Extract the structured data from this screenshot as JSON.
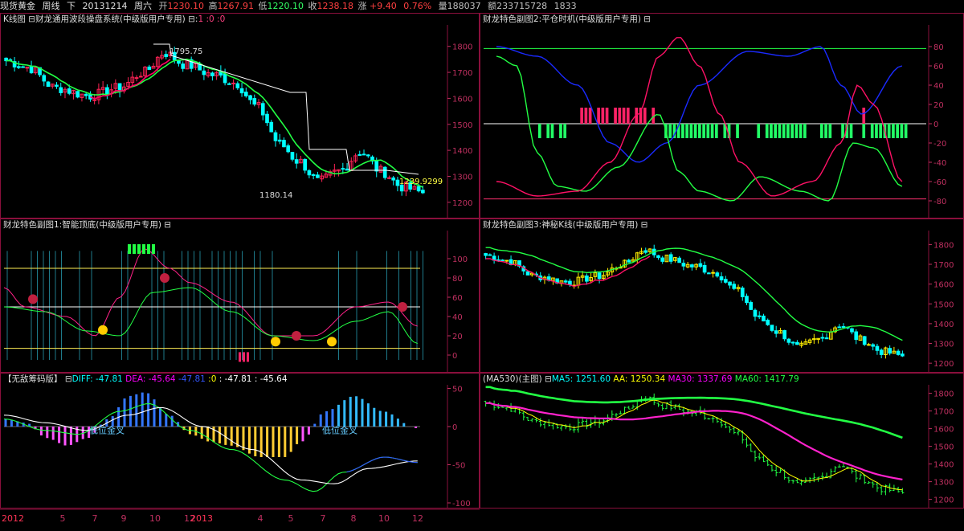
{
  "topbar": {
    "symbol": "现货黄金",
    "period": "周线",
    "dir": "下",
    "date": "20131214",
    "weekday": "周六",
    "open_label": "开",
    "open": "1230.10",
    "high_label": "高",
    "high": "1267.91",
    "low_label": "低",
    "low": "1220.10",
    "close_label": "收",
    "close": "1238.18",
    "chg_label": "涨",
    "chg": "+9.40",
    "pct": "0.76%",
    "vol": "量188037",
    "amt": "额233715728",
    "extra": "1833"
  },
  "panels": {
    "k": {
      "title": "K线图",
      "subtitle": "财龙通用波段操盘系统(中级版用户专用)",
      "params": "1 :0 :0",
      "high_label": "1795.75",
      "low_label": "1180.14",
      "last_label": "1239.9299",
      "yticks": [
        "1800",
        "1700",
        "1600",
        "1500",
        "1400",
        "1300",
        "1200"
      ]
    },
    "sub1": {
      "title": "财龙特色副图1:智能顶底(中级版用户专用)",
      "yticks": [
        "100",
        "80",
        "60",
        "40",
        "20",
        "0"
      ]
    },
    "sub2": {
      "title": "财龙特色副图2:平仓时机(中级版用户专用)",
      "yticks": [
        "80",
        "60",
        "40",
        "20",
        "0",
        "-20",
        "-40",
        "-60",
        "-80"
      ]
    },
    "sub3": {
      "title": "财龙特色副图3:神秘K线(中级版用户专用)",
      "yticks": [
        "1800",
        "1700",
        "1600",
        "1500",
        "1400",
        "1300",
        "1200"
      ]
    },
    "macd": {
      "title": "【无敌筹码版】",
      "diff": "DIFF: -47.81",
      "dea": "DEA: -45.64",
      "v1": "-47.81",
      "v2": ":0",
      "v3": ": -47.81",
      "v4": ": -45.64",
      "label1": "低位金叉",
      "label2": "低位金叉",
      "yticks": [
        "50",
        "0",
        "-50",
        "-100"
      ]
    },
    "ma": {
      "title": "(MA530)(主图)",
      "ma5": "MA5: 1251.60",
      "aa": "AA: 1250.34",
      "ma30": "MA30: 1337.69",
      "ma60": "MA60: 1417.79",
      "yticks": [
        "1800",
        "1700",
        "1600",
        "1500",
        "1400",
        "1300",
        "1200"
      ]
    }
  },
  "xaxis": {
    "labels": [
      "2012",
      "5",
      "7",
      "9",
      "10",
      "12",
      "2013",
      "4",
      "5",
      "7",
      "8",
      "10",
      "12"
    ]
  },
  "colors": {
    "up": "#ff2255",
    "down": "#00ffff",
    "green": "#22ff44",
    "magenta": "#ff00aa",
    "yellow": "#ffff00",
    "red": "#ff3030",
    "border": "#8a0f3c"
  }
}
